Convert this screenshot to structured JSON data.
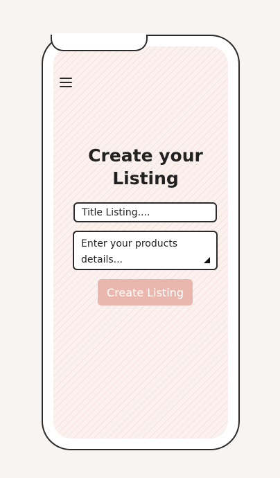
{
  "header": {
    "menu_icon": "hamburger-menu-icon"
  },
  "main": {
    "title_line1": "Create your",
    "title_line2": "Listing",
    "title_field": {
      "placeholder": "Title Listing....",
      "value": ""
    },
    "details_field": {
      "placeholder": "Enter your products details...",
      "value": ""
    },
    "create_button_label": "Create Listing"
  },
  "colors": {
    "page_background": "#f8f4f1",
    "screen_background": "#fbf1ef",
    "button_background": "#e9b7ad",
    "button_text": "#ffffff",
    "text": "#222222"
  }
}
